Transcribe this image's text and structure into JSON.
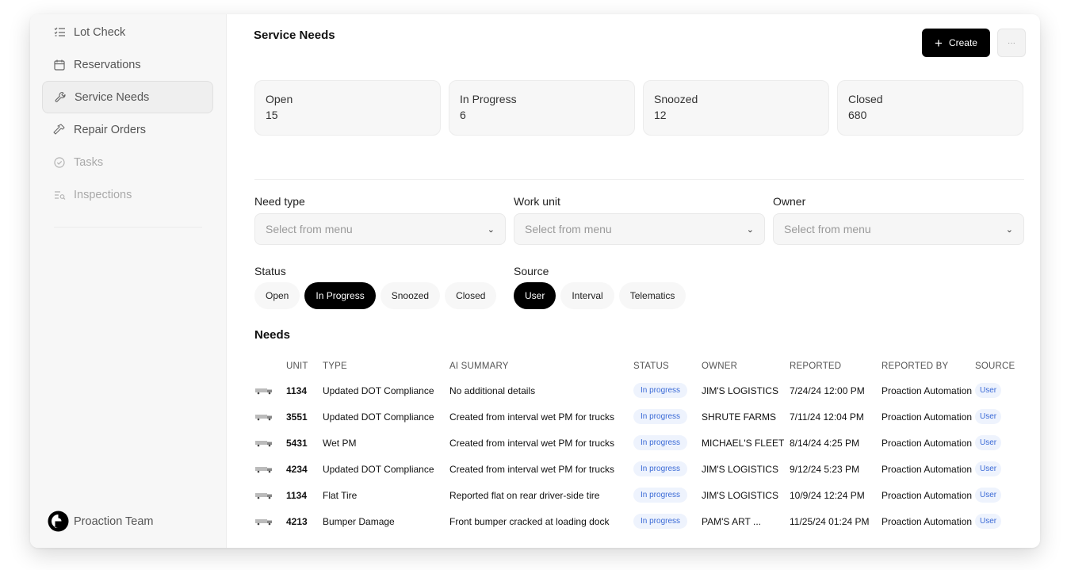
{
  "sidebar": {
    "items": [
      {
        "label": "Lot Check",
        "icon": "checklist-icon"
      },
      {
        "label": "Reservations",
        "icon": "calendar-icon"
      },
      {
        "label": "Service Needs",
        "icon": "wrench-icon"
      },
      {
        "label": "Repair Orders",
        "icon": "hammer-icon"
      },
      {
        "label": "Tasks",
        "icon": "check-circle-icon"
      },
      {
        "label": "Inspections",
        "icon": "inspection-list-icon"
      }
    ],
    "team": "Proaction Team"
  },
  "header": {
    "title": "Service Needs",
    "create_label": "Create",
    "more_label": "···"
  },
  "stats": [
    {
      "label": "Open",
      "value": "15"
    },
    {
      "label": "In Progress",
      "value": "6"
    },
    {
      "label": "Snoozed",
      "value": "12"
    },
    {
      "label": "Closed",
      "value": "680"
    }
  ],
  "filters": [
    {
      "label": "Need type",
      "placeholder": "Select from menu"
    },
    {
      "label": "Work unit",
      "placeholder": "Select from menu"
    },
    {
      "label": "Owner",
      "placeholder": "Select from menu"
    }
  ],
  "status_filter": {
    "label": "Status",
    "options": [
      "Open",
      "In Progress",
      "Snoozed",
      "Closed"
    ],
    "selected": "In Progress"
  },
  "source_filter": {
    "label": "Source",
    "options": [
      "User",
      "Interval",
      "Telematics"
    ],
    "selected": "User"
  },
  "needs": {
    "title": "Needs",
    "columns": [
      "UNIT",
      "TYPE",
      "AI SUMMARY",
      "STATUS",
      "OWNER",
      "REPORTED",
      "REPORTED BY",
      "SOURCE"
    ],
    "rows": [
      {
        "unit": "1134",
        "type": "Updated DOT Compliance",
        "summary": "No additional details",
        "status": "In progress",
        "owner": "JIM'S LOGISTICS",
        "reported": "7/24/24 12:00 PM",
        "by": "Proaction Automation",
        "source": "User"
      },
      {
        "unit": "3551",
        "type": "Updated DOT Compliance",
        "summary": "Created from interval wet PM for trucks",
        "status": "In progress",
        "owner": "SHRUTE FARMS",
        "reported": "7/11/24 12:04 PM",
        "by": "Proaction Automation",
        "source": "User"
      },
      {
        "unit": "5431",
        "type": "Wet PM",
        "summary": "Created from interval wet PM for trucks",
        "status": "In progress",
        "owner": "MICHAEL'S FLEET",
        "reported": "8/14/24 4:25 PM",
        "by": "Proaction Automation",
        "source": "User"
      },
      {
        "unit": "4234",
        "type": "Updated DOT Compliance",
        "summary": "Created from interval wet PM for trucks",
        "status": "In progress",
        "owner": "JIM'S LOGISTICS",
        "reported": "9/12/24 5:23 PM",
        "by": "Proaction Automation",
        "source": "User"
      },
      {
        "unit": "1134",
        "type": "Flat Tire",
        "summary": "Reported flat on rear driver-side tire",
        "status": "In progress",
        "owner": "JIM'S LOGISTICS",
        "reported": "10/9/24 12:24 PM",
        "by": "Proaction Automation",
        "source": "User"
      },
      {
        "unit": "4213",
        "type": "Bumper Damage",
        "summary": "Front bumper cracked at loading dock",
        "status": "In progress",
        "owner": "PAM'S ART ...",
        "reported": "11/25/24 01:24 PM",
        "by": "Proaction Automation",
        "source": "User"
      }
    ]
  },
  "colors": {
    "accent": "#000000",
    "pill_text": "#3a6ad6",
    "pill_bg": "#eef3fd"
  }
}
